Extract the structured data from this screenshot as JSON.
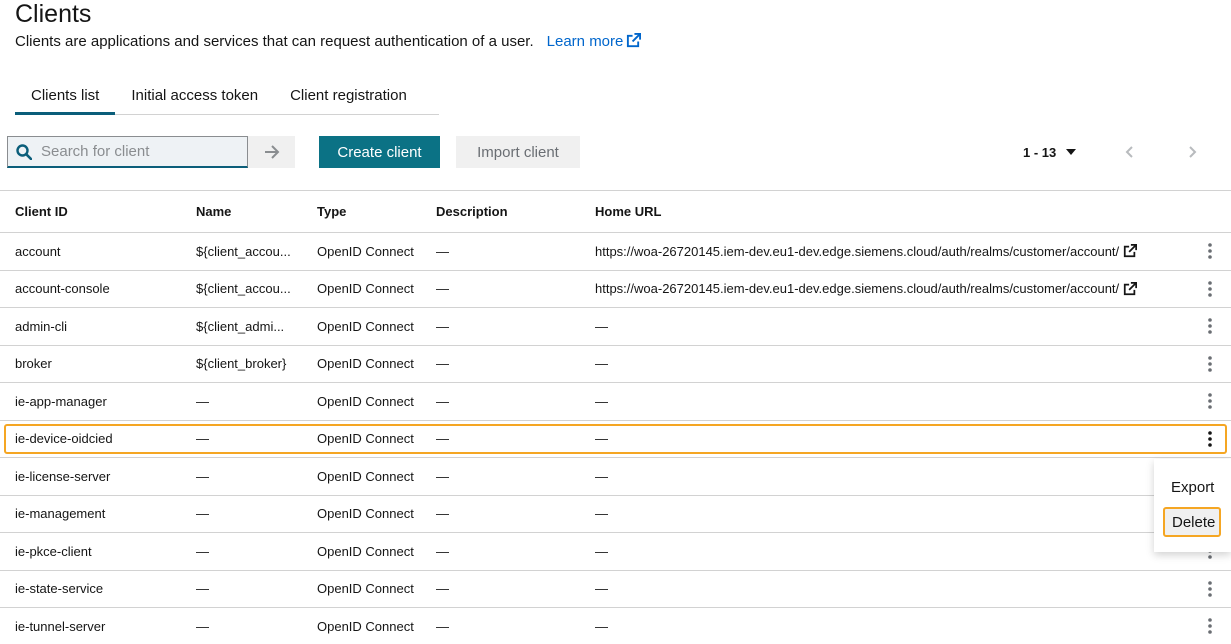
{
  "header": {
    "title": "Clients",
    "description": "Clients are applications and services that can request authentication of a user.",
    "learn_more": "Learn more"
  },
  "tabs": [
    {
      "label": "Clients list",
      "active": true
    },
    {
      "label": "Initial access token",
      "active": false
    },
    {
      "label": "Client registration",
      "active": false
    }
  ],
  "toolbar": {
    "search_placeholder": "Search for client",
    "search_value": "",
    "create_label": "Create client",
    "import_label": "Import client",
    "pagination": "1 - 13"
  },
  "colors": {
    "accent": "#0b7285",
    "link": "#0066cc",
    "highlight": "#f5a623"
  },
  "table": {
    "headers": {
      "client_id": "Client ID",
      "name": "Name",
      "type": "Type",
      "description": "Description",
      "home_url": "Home URL"
    },
    "rows": [
      {
        "client_id": "account",
        "name": "${client_accou...",
        "type": "OpenID Connect",
        "description": "—",
        "home_url": "https://woa-26720145.iem-dev.eu1-dev.edge.siemens.cloud/auth/realms/customer/account/"
      },
      {
        "client_id": "account-console",
        "name": "${client_accou...",
        "type": "OpenID Connect",
        "description": "—",
        "home_url": "https://woa-26720145.iem-dev.eu1-dev.edge.siemens.cloud/auth/realms/customer/account/"
      },
      {
        "client_id": "admin-cli",
        "name": "${client_admi...",
        "type": "OpenID Connect",
        "description": "—",
        "home_url": "—"
      },
      {
        "client_id": "broker",
        "name": "${client_broker}",
        "type": "OpenID Connect",
        "description": "—",
        "home_url": "—"
      },
      {
        "client_id": "ie-app-manager",
        "name": "—",
        "type": "OpenID Connect",
        "description": "—",
        "home_url": "—"
      },
      {
        "client_id": "ie-device-oidcied",
        "name": "—",
        "type": "OpenID Connect",
        "description": "—",
        "home_url": "—"
      },
      {
        "client_id": "ie-license-server",
        "name": "—",
        "type": "OpenID Connect",
        "description": "—",
        "home_url": "—"
      },
      {
        "client_id": "ie-management",
        "name": "—",
        "type": "OpenID Connect",
        "description": "—",
        "home_url": "—"
      },
      {
        "client_id": "ie-pkce-client",
        "name": "—",
        "type": "OpenID Connect",
        "description": "—",
        "home_url": "—"
      },
      {
        "client_id": "ie-state-service",
        "name": "—",
        "type": "OpenID Connect",
        "description": "—",
        "home_url": "—"
      },
      {
        "client_id": "ie-tunnel-server",
        "name": "—",
        "type": "OpenID Connect",
        "description": "—",
        "home_url": "—"
      }
    ]
  },
  "row_menu": {
    "export_label": "Export",
    "delete_label": "Delete"
  }
}
